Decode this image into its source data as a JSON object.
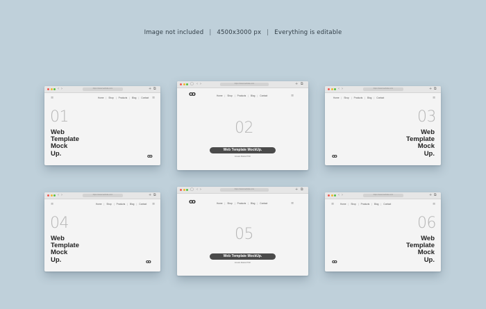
{
  "caption": {
    "left": "Image not included",
    "sep": "|",
    "middle": "4500x3000 px",
    "right": "Everything is editable"
  },
  "browser": {
    "address_text": "https://www.website.com",
    "back_icon": "chevron-left-icon",
    "forward_icon": "chevron-right-icon",
    "new_tab_icon": "plus-icon",
    "tabs_icon": "tabs-icon"
  },
  "nav_menu": [
    "Home",
    "Shop",
    "Products",
    "Blog",
    "Contact"
  ],
  "menu_pipe": "|",
  "logo_text": "ꝏ",
  "hamburger": "≡",
  "headline_lines": [
    "Web",
    "Template",
    "Mock",
    "Up."
  ],
  "cta": {
    "label": "Web Template MockUp.",
    "sub": "Envato Market PSD"
  },
  "windows": [
    {
      "number": "01"
    },
    {
      "number": "02"
    },
    {
      "number": "03"
    },
    {
      "number": "04"
    },
    {
      "number": "05"
    },
    {
      "number": "06"
    }
  ]
}
